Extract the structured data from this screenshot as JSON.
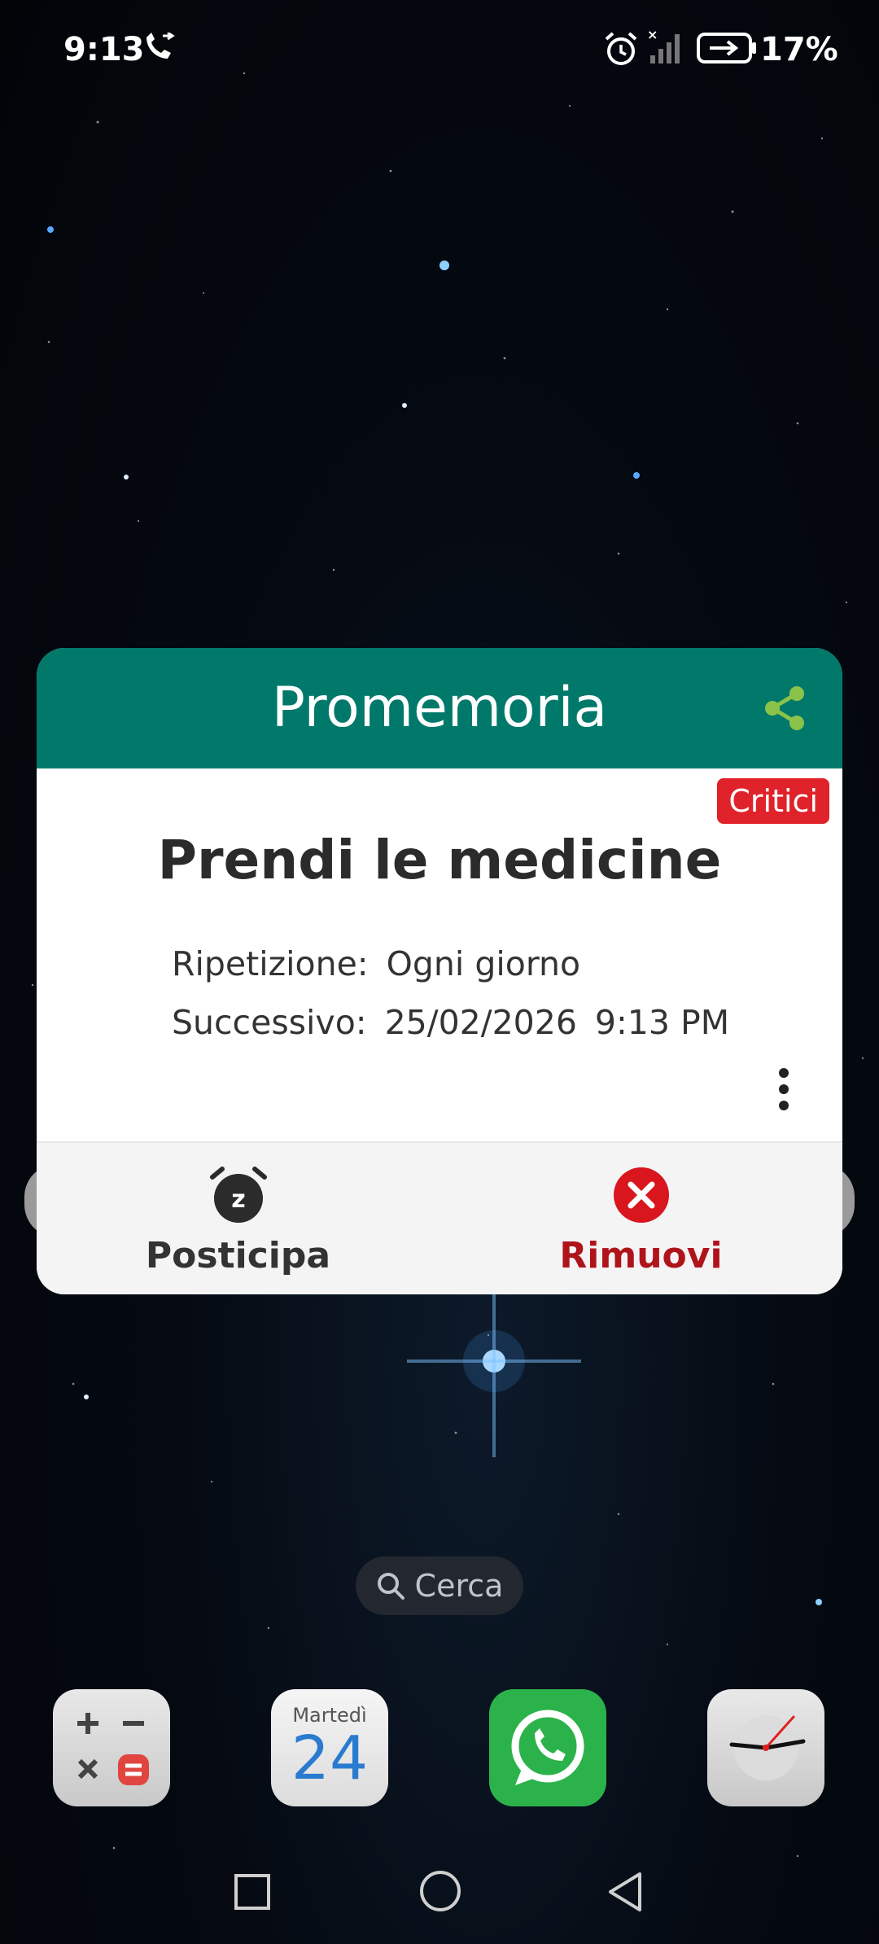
{
  "status_bar": {
    "time": "9:13",
    "battery": "17%"
  },
  "dialog": {
    "title": "Promemoria",
    "badge": "Critici",
    "task_title": "Prendi le medicine",
    "repeat_label": "Ripetizione:",
    "repeat_value": "Ogni giorno",
    "next_label": "Successivo:",
    "next_date": "25/02/2026",
    "next_time": "9:13 PM",
    "snooze_label": "Posticipa",
    "remove_label": "Rimuovi"
  },
  "home": {
    "search_label": "Cerca",
    "calendar_day": "Martedì",
    "calendar_date": "24"
  },
  "colors": {
    "header": "#00796b",
    "share_icon": "#8bc34a",
    "badge": "#e0222a",
    "remove": "#b0141b"
  },
  "icons": [
    "call-icon",
    "alarm-icon",
    "signal-icon",
    "battery-charging-icon",
    "share-icon",
    "more-vert-icon",
    "snooze-alarm-icon",
    "close-circle-icon",
    "search-icon",
    "calculator-icon",
    "calendar-icon",
    "whatsapp-icon",
    "clock-icon"
  ]
}
